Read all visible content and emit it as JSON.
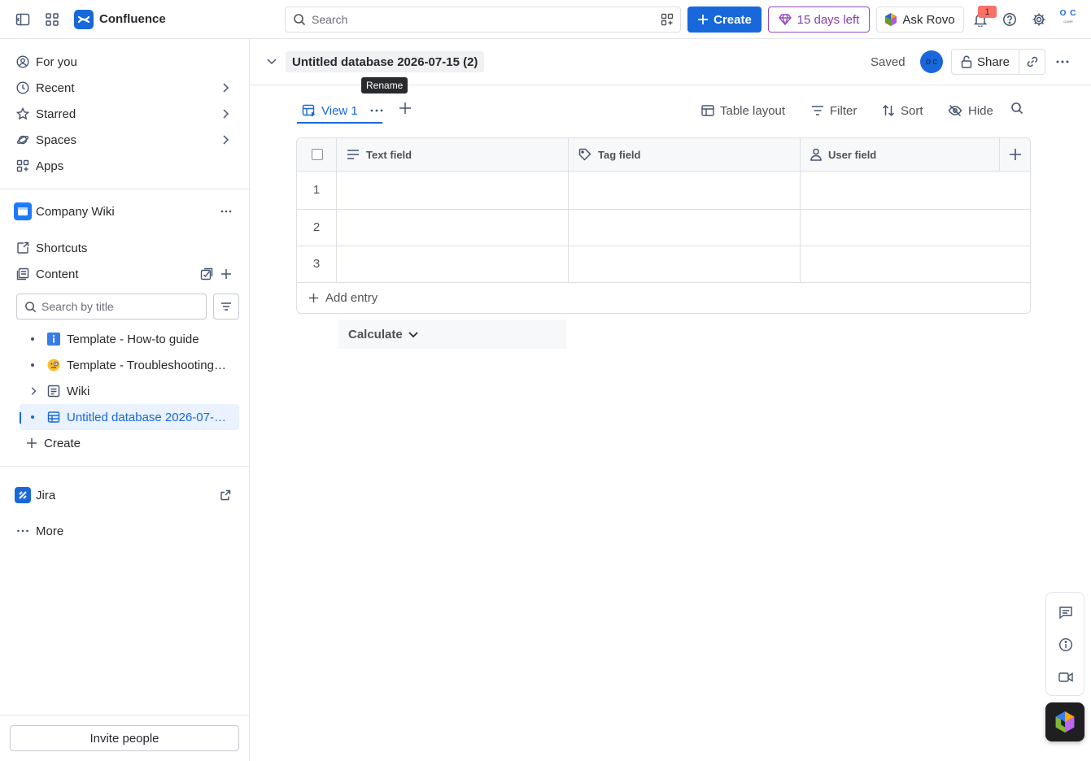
{
  "topbar": {
    "brand": "Confluence",
    "search_placeholder": "Search",
    "create_label": "Create",
    "trial_label": "15 days left",
    "rovo_label": "Ask Rovo",
    "notification_count": "1",
    "profile_initials_top": "O C",
    "profile_initials_bottom": "CORP"
  },
  "sidebar": {
    "nav": [
      {
        "label": "For you"
      },
      {
        "label": "Recent"
      },
      {
        "label": "Starred"
      },
      {
        "label": "Spaces"
      },
      {
        "label": "Apps"
      }
    ],
    "space_name": "Company Wiki",
    "shortcuts_label": "Shortcuts",
    "content_label": "Content",
    "search_placeholder": "Search by title",
    "tree": [
      {
        "label": "Template - How-to guide"
      },
      {
        "label": "Template - Troubleshooting article"
      },
      {
        "label": "Wiki"
      },
      {
        "label": "Untitled database 2026-07-15 (2)"
      }
    ],
    "create_label": "Create",
    "jira_label": "Jira",
    "more_label": "More",
    "invite_label": "Invite people"
  },
  "page": {
    "title": "Untitled database 2026-07-15 (2)",
    "tooltip": "Rename",
    "saved_label": "Saved",
    "avatar_initials": "O C",
    "share_label": "Share"
  },
  "view": {
    "tab_label": "View 1",
    "toolbar": {
      "layout": "Table layout",
      "filter": "Filter",
      "sort": "Sort",
      "hide": "Hide"
    }
  },
  "table": {
    "columns": [
      {
        "label": "Text field"
      },
      {
        "label": "Tag field"
      },
      {
        "label": "User field"
      }
    ],
    "rows": [
      {
        "num": "1"
      },
      {
        "num": "2"
      },
      {
        "num": "3"
      }
    ],
    "add_entry_label": "Add entry",
    "calculate_label": "Calculate"
  },
  "colors": {
    "accent": "#1868DB",
    "trial": "#803FA5",
    "badge": "#F87168"
  }
}
